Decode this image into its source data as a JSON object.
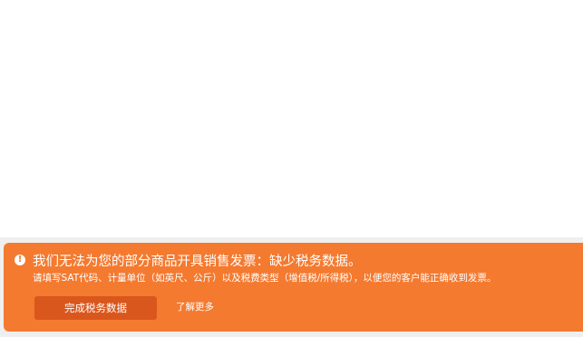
{
  "banner": {
    "icon": "alert-circle-icon",
    "icon_glyph": "!",
    "title": "我们无法为您的部分商品开具销售发票：缺少税务数据。",
    "description": "请填写SAT代码、计量单位（如英尺、公斤）以及税费类型（增值税/所得税），以便您的客户能正确收到发票。",
    "primary_button_label": "完成税务数据",
    "link_label": "了解更多",
    "colors": {
      "background": "#f47a30",
      "button": "#d9571c",
      "text": "#ffffff"
    }
  }
}
